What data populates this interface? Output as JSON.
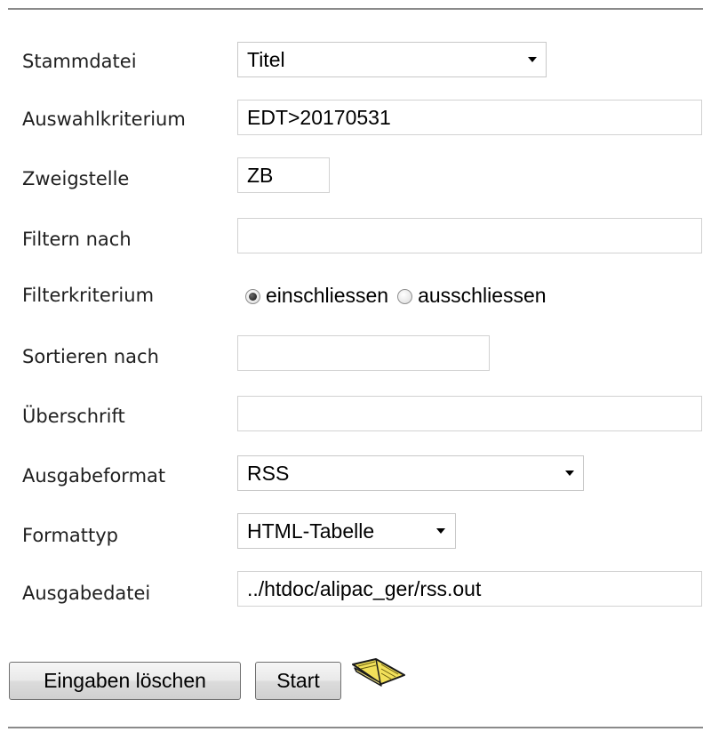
{
  "form": {
    "stammdatei": {
      "label": "Stammdatei",
      "selected": "Titel"
    },
    "auswahlkriterium": {
      "label": "Auswahlkriterium",
      "value": "EDT>20170531"
    },
    "zweigstelle": {
      "label": "Zweigstelle",
      "value": "ZB"
    },
    "filtern_nach": {
      "label": "Filtern nach",
      "value": ""
    },
    "filterkriterium": {
      "label": "Filterkriterium",
      "options": [
        {
          "label": "einschliessen",
          "checked": true
        },
        {
          "label": "ausschliessen",
          "checked": false
        }
      ]
    },
    "sortieren_nach": {
      "label": "Sortieren nach",
      "value": ""
    },
    "ueberschrift": {
      "label": "Überschrift",
      "value": ""
    },
    "ausgabeformat": {
      "label": "Ausgabeformat",
      "selected": "RSS"
    },
    "formattyp": {
      "label": "Formattyp",
      "selected": "HTML-Tabelle"
    },
    "ausgabedatei": {
      "label": "Ausgabedatei",
      "value": "../htdoc/alipac_ger/rss.out"
    }
  },
  "buttons": {
    "clear_label": "Eingaben löschen",
    "start_label": "Start"
  },
  "icons": {
    "help": "open-book-icon"
  }
}
